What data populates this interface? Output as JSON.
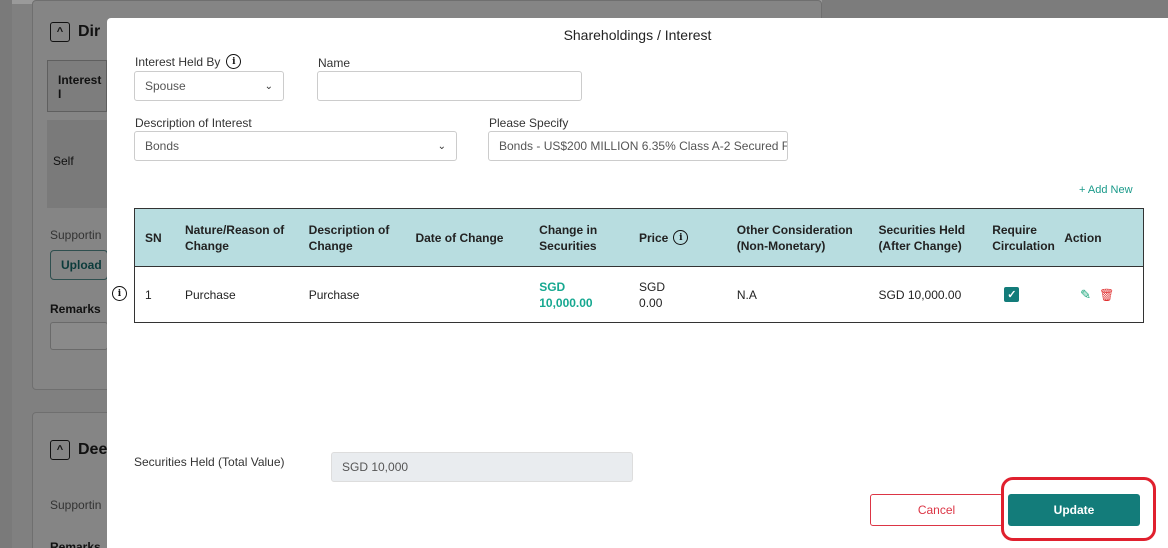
{
  "background": {
    "section1_title": "Dir",
    "section2_title": "Dee",
    "table_header_fragment": "Interest I",
    "row_fragment": "Self",
    "supporting_fragment": "Supportin",
    "upload_label": "Upload",
    "remarks_label": "Remarks",
    "supporting_fragment2": "Supportin",
    "remarks_label2": "Remarks"
  },
  "modal": {
    "title": "Shareholdings / Interest",
    "interest_held_by": {
      "label": "Interest Held By",
      "value": "Spouse"
    },
    "name": {
      "label": "Name",
      "value": ""
    },
    "description_of_interest": {
      "label": "Description of Interest",
      "value": "Bonds"
    },
    "please_specify": {
      "label": "Please Specify",
      "value": "Bonds - US$200 MILLION 6.35% Class A-2 Secured F"
    },
    "add_new_label": "+ Add New",
    "table": {
      "headers": {
        "sn": "SN",
        "nature": [
          "Nature/Reason of",
          "Change"
        ],
        "description": [
          "Description of",
          "Change"
        ],
        "date": "Date of Change",
        "change": [
          "Change in",
          "Securities"
        ],
        "price": "Price",
        "other": [
          "Other Consideration",
          "(Non-Monetary)"
        ],
        "held": [
          "Securities Held",
          "(After Change)"
        ],
        "circulation": [
          "Require",
          "Circulation"
        ],
        "action": "Action"
      },
      "rows": [
        {
          "sn": "1",
          "nature": "Purchase",
          "description": "Purchase",
          "date": "",
          "change": [
            "SGD",
            "10,000.00"
          ],
          "price": [
            "SGD",
            "0.00"
          ],
          "other": "N.A",
          "held": "SGD 10,000.00",
          "circulation_checked": true
        }
      ]
    },
    "total": {
      "label": "Securities Held (Total Value)",
      "value": "SGD  10,000"
    },
    "cancel_label": "Cancel",
    "update_label": "Update"
  },
  "colors": {
    "accent": "#137c7a",
    "header_bg": "#b8dde0",
    "green_text": "#16a890",
    "danger": "#dc3545",
    "highlight": "#e0202e"
  },
  "icons": [
    "info-icon",
    "chevron-down-icon",
    "pencil-icon",
    "trash-icon",
    "check-icon",
    "chevron-up-icon"
  ]
}
